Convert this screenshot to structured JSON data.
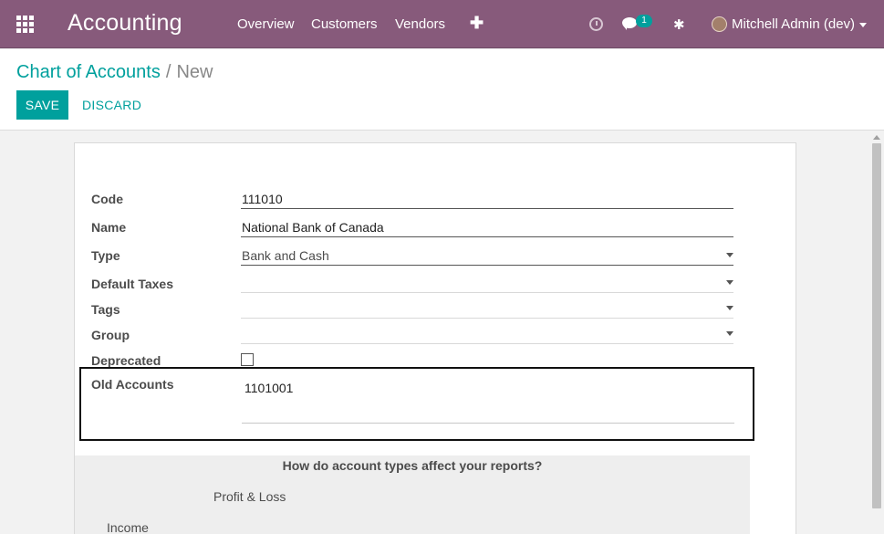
{
  "navbar": {
    "app_title": "Accounting",
    "menu": [
      "Overview",
      "Customers",
      "Vendors"
    ],
    "chat_badge": "1",
    "user_name": "Mitchell Admin (dev)"
  },
  "breadcrumb": {
    "parent": "Chart of Accounts",
    "separator": "/",
    "current": "New"
  },
  "buttons": {
    "save": "SAVE",
    "discard": "DISCARD"
  },
  "form": {
    "code": {
      "label": "Code",
      "value": "111010"
    },
    "name": {
      "label": "Name",
      "value": "National Bank of Canada"
    },
    "type": {
      "label": "Type",
      "value": "Bank and Cash"
    },
    "default_taxes": {
      "label": "Default Taxes",
      "value": ""
    },
    "tags": {
      "label": "Tags",
      "value": ""
    },
    "group": {
      "label": "Group",
      "value": ""
    },
    "deprecated": {
      "label": "Deprecated",
      "checked": false
    },
    "old_accounts": {
      "label": "Old Accounts",
      "value": "1101001"
    }
  },
  "help": {
    "title": "How do account types affect your reports?",
    "profit_loss": "Profit & Loss",
    "income": "Income"
  },
  "colors": {
    "navbar": "#875a7b",
    "accent": "#00a09d"
  }
}
